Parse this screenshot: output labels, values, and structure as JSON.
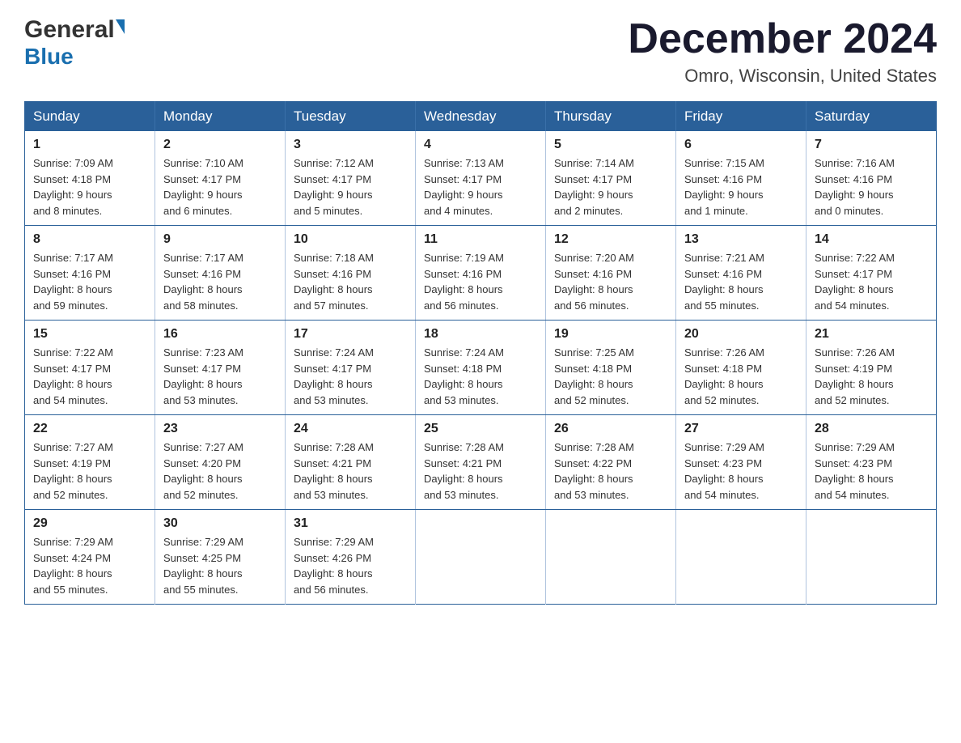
{
  "header": {
    "logo_general": "General",
    "logo_blue": "Blue",
    "month_title": "December 2024",
    "location": "Omro, Wisconsin, United States"
  },
  "days_of_week": [
    "Sunday",
    "Monday",
    "Tuesday",
    "Wednesday",
    "Thursday",
    "Friday",
    "Saturday"
  ],
  "weeks": [
    [
      {
        "day": "1",
        "sunrise": "Sunrise: 7:09 AM",
        "sunset": "Sunset: 4:18 PM",
        "daylight": "Daylight: 9 hours",
        "daylight2": "and 8 minutes."
      },
      {
        "day": "2",
        "sunrise": "Sunrise: 7:10 AM",
        "sunset": "Sunset: 4:17 PM",
        "daylight": "Daylight: 9 hours",
        "daylight2": "and 6 minutes."
      },
      {
        "day": "3",
        "sunrise": "Sunrise: 7:12 AM",
        "sunset": "Sunset: 4:17 PM",
        "daylight": "Daylight: 9 hours",
        "daylight2": "and 5 minutes."
      },
      {
        "day": "4",
        "sunrise": "Sunrise: 7:13 AM",
        "sunset": "Sunset: 4:17 PM",
        "daylight": "Daylight: 9 hours",
        "daylight2": "and 4 minutes."
      },
      {
        "day": "5",
        "sunrise": "Sunrise: 7:14 AM",
        "sunset": "Sunset: 4:17 PM",
        "daylight": "Daylight: 9 hours",
        "daylight2": "and 2 minutes."
      },
      {
        "day": "6",
        "sunrise": "Sunrise: 7:15 AM",
        "sunset": "Sunset: 4:16 PM",
        "daylight": "Daylight: 9 hours",
        "daylight2": "and 1 minute."
      },
      {
        "day": "7",
        "sunrise": "Sunrise: 7:16 AM",
        "sunset": "Sunset: 4:16 PM",
        "daylight": "Daylight: 9 hours",
        "daylight2": "and 0 minutes."
      }
    ],
    [
      {
        "day": "8",
        "sunrise": "Sunrise: 7:17 AM",
        "sunset": "Sunset: 4:16 PM",
        "daylight": "Daylight: 8 hours",
        "daylight2": "and 59 minutes."
      },
      {
        "day": "9",
        "sunrise": "Sunrise: 7:17 AM",
        "sunset": "Sunset: 4:16 PM",
        "daylight": "Daylight: 8 hours",
        "daylight2": "and 58 minutes."
      },
      {
        "day": "10",
        "sunrise": "Sunrise: 7:18 AM",
        "sunset": "Sunset: 4:16 PM",
        "daylight": "Daylight: 8 hours",
        "daylight2": "and 57 minutes."
      },
      {
        "day": "11",
        "sunrise": "Sunrise: 7:19 AM",
        "sunset": "Sunset: 4:16 PM",
        "daylight": "Daylight: 8 hours",
        "daylight2": "and 56 minutes."
      },
      {
        "day": "12",
        "sunrise": "Sunrise: 7:20 AM",
        "sunset": "Sunset: 4:16 PM",
        "daylight": "Daylight: 8 hours",
        "daylight2": "and 56 minutes."
      },
      {
        "day": "13",
        "sunrise": "Sunrise: 7:21 AM",
        "sunset": "Sunset: 4:16 PM",
        "daylight": "Daylight: 8 hours",
        "daylight2": "and 55 minutes."
      },
      {
        "day": "14",
        "sunrise": "Sunrise: 7:22 AM",
        "sunset": "Sunset: 4:17 PM",
        "daylight": "Daylight: 8 hours",
        "daylight2": "and 54 minutes."
      }
    ],
    [
      {
        "day": "15",
        "sunrise": "Sunrise: 7:22 AM",
        "sunset": "Sunset: 4:17 PM",
        "daylight": "Daylight: 8 hours",
        "daylight2": "and 54 minutes."
      },
      {
        "day": "16",
        "sunrise": "Sunrise: 7:23 AM",
        "sunset": "Sunset: 4:17 PM",
        "daylight": "Daylight: 8 hours",
        "daylight2": "and 53 minutes."
      },
      {
        "day": "17",
        "sunrise": "Sunrise: 7:24 AM",
        "sunset": "Sunset: 4:17 PM",
        "daylight": "Daylight: 8 hours",
        "daylight2": "and 53 minutes."
      },
      {
        "day": "18",
        "sunrise": "Sunrise: 7:24 AM",
        "sunset": "Sunset: 4:18 PM",
        "daylight": "Daylight: 8 hours",
        "daylight2": "and 53 minutes."
      },
      {
        "day": "19",
        "sunrise": "Sunrise: 7:25 AM",
        "sunset": "Sunset: 4:18 PM",
        "daylight": "Daylight: 8 hours",
        "daylight2": "and 52 minutes."
      },
      {
        "day": "20",
        "sunrise": "Sunrise: 7:26 AM",
        "sunset": "Sunset: 4:18 PM",
        "daylight": "Daylight: 8 hours",
        "daylight2": "and 52 minutes."
      },
      {
        "day": "21",
        "sunrise": "Sunrise: 7:26 AM",
        "sunset": "Sunset: 4:19 PM",
        "daylight": "Daylight: 8 hours",
        "daylight2": "and 52 minutes."
      }
    ],
    [
      {
        "day": "22",
        "sunrise": "Sunrise: 7:27 AM",
        "sunset": "Sunset: 4:19 PM",
        "daylight": "Daylight: 8 hours",
        "daylight2": "and 52 minutes."
      },
      {
        "day": "23",
        "sunrise": "Sunrise: 7:27 AM",
        "sunset": "Sunset: 4:20 PM",
        "daylight": "Daylight: 8 hours",
        "daylight2": "and 52 minutes."
      },
      {
        "day": "24",
        "sunrise": "Sunrise: 7:28 AM",
        "sunset": "Sunset: 4:21 PM",
        "daylight": "Daylight: 8 hours",
        "daylight2": "and 53 minutes."
      },
      {
        "day": "25",
        "sunrise": "Sunrise: 7:28 AM",
        "sunset": "Sunset: 4:21 PM",
        "daylight": "Daylight: 8 hours",
        "daylight2": "and 53 minutes."
      },
      {
        "day": "26",
        "sunrise": "Sunrise: 7:28 AM",
        "sunset": "Sunset: 4:22 PM",
        "daylight": "Daylight: 8 hours",
        "daylight2": "and 53 minutes."
      },
      {
        "day": "27",
        "sunrise": "Sunrise: 7:29 AM",
        "sunset": "Sunset: 4:23 PM",
        "daylight": "Daylight: 8 hours",
        "daylight2": "and 54 minutes."
      },
      {
        "day": "28",
        "sunrise": "Sunrise: 7:29 AM",
        "sunset": "Sunset: 4:23 PM",
        "daylight": "Daylight: 8 hours",
        "daylight2": "and 54 minutes."
      }
    ],
    [
      {
        "day": "29",
        "sunrise": "Sunrise: 7:29 AM",
        "sunset": "Sunset: 4:24 PM",
        "daylight": "Daylight: 8 hours",
        "daylight2": "and 55 minutes."
      },
      {
        "day": "30",
        "sunrise": "Sunrise: 7:29 AM",
        "sunset": "Sunset: 4:25 PM",
        "daylight": "Daylight: 8 hours",
        "daylight2": "and 55 minutes."
      },
      {
        "day": "31",
        "sunrise": "Sunrise: 7:29 AM",
        "sunset": "Sunset: 4:26 PM",
        "daylight": "Daylight: 8 hours",
        "daylight2": "and 56 minutes."
      },
      null,
      null,
      null,
      null
    ]
  ]
}
